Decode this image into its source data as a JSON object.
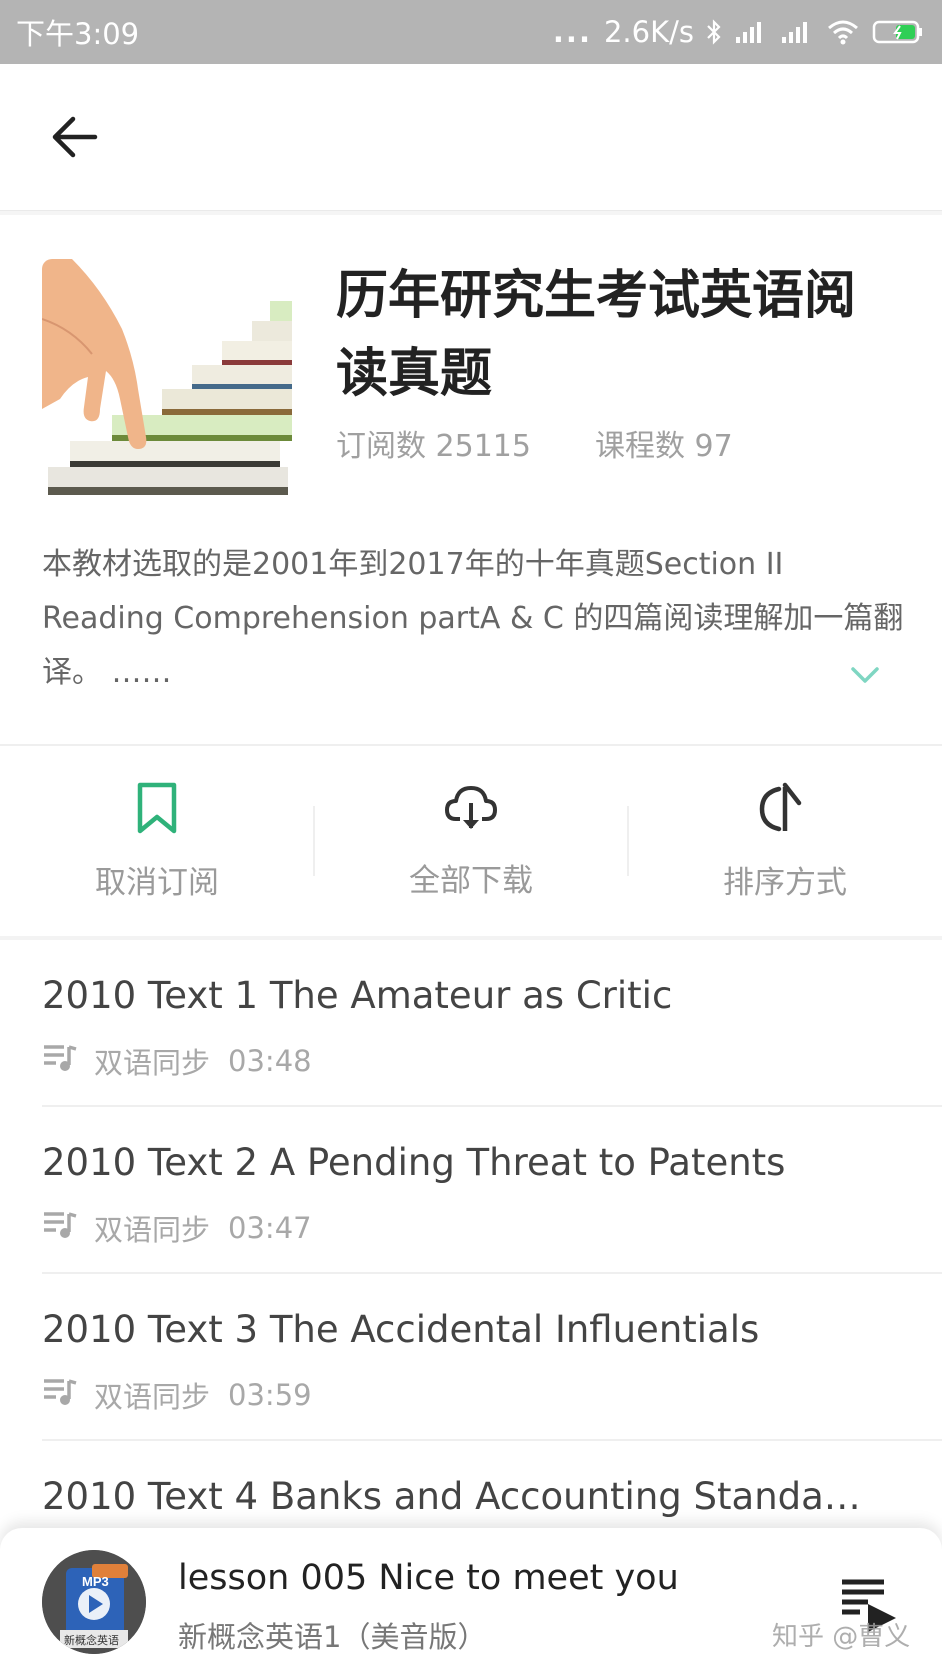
{
  "status_bar": {
    "time": "下午3:09",
    "dots": "...",
    "net_speed": "2.6K/s"
  },
  "course": {
    "title_line1": "历年研究生考试英语阅",
    "title_line2": "读真题",
    "subscribers": "订阅数 25115",
    "lessons": "课程数 97",
    "description_line1": "本教材选取的是2001年到2017年的十年真题Section II",
    "description_line2": "Reading Comprehension partA & C 的四篇阅读理解加一篇翻",
    "description_line3": "译。 ……"
  },
  "actions": [
    {
      "label": "取消订阅",
      "icon": "bookmark-icon"
    },
    {
      "label": "全部下载",
      "icon": "cloud-download-icon"
    },
    {
      "label": "排序方式",
      "icon": "sort-icon"
    }
  ],
  "lessons": [
    {
      "title": "2010 Text 1 The Amateur as Critic",
      "type": "双语同步",
      "duration": "03:48"
    },
    {
      "title": "2010 Text 2 A Pending Threat to Patents",
      "type": "双语同步",
      "duration": "03:47"
    },
    {
      "title": "2010 Text 3 The Accidental Influentials",
      "type": "双语同步",
      "duration": "03:59"
    },
    {
      "title": "2010 Text 4 Banks and Accounting Standa…",
      "type": "",
      "duration": ""
    }
  ],
  "player": {
    "title": "lesson 005  Nice to meet you",
    "subtitle": "新概念英语1（美音版）",
    "art_text": "MP3",
    "art_caption": "新概念英语"
  },
  "watermark": "知乎 @曹义",
  "colors": {
    "accent": "#2fb27a",
    "status_bar": "#b4b4b4",
    "chevron": "#7fd6c2"
  }
}
